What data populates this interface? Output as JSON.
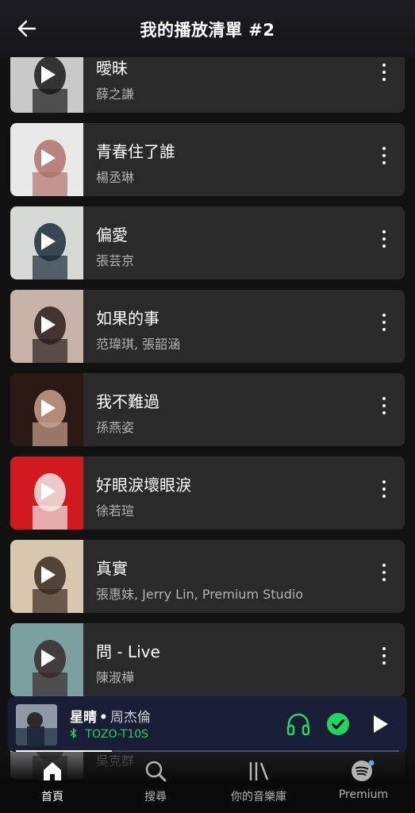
{
  "header": {
    "title": "我的播放清單 #2"
  },
  "songs": [
    {
      "title": "曖昧",
      "artist": "薛之謙",
      "cover_colors": [
        "#c9c9c9",
        "#1a1a1a"
      ]
    },
    {
      "title": "青春住了誰",
      "artist": "楊丞琳",
      "cover_colors": [
        "#e9e9e9",
        "#b0726a"
      ]
    },
    {
      "title": "偏愛",
      "artist": "張芸京",
      "cover_colors": [
        "#d6d9d4",
        "#1b2b3a"
      ]
    },
    {
      "title": "如果的事",
      "artist": "范瑋琪, 張韶涵",
      "cover_colors": [
        "#c8b3a8",
        "#2a1f1c"
      ]
    },
    {
      "title": "我不難過",
      "artist": "孫燕姿",
      "cover_colors": [
        "#2b1a14",
        "#c9a08a"
      ]
    },
    {
      "title": "好眼淚壞眼淚",
      "artist": "徐若瑄",
      "cover_colors": [
        "#d11a1e",
        "#f2e9e9"
      ]
    },
    {
      "title": "真實",
      "artist": "張惠妹, Jerry Lin, Premium Studio",
      "cover_colors": [
        "#d7c7ad",
        "#3b2b22"
      ]
    },
    {
      "title": "問 - Live",
      "artist": "陳淑樺",
      "cover_colors": [
        "#7aa0a0",
        "#3a2a2a"
      ]
    },
    {
      "title": "",
      "artist": "吳克群",
      "cover_colors": [
        "#cfcfcf",
        "#555555"
      ]
    }
  ],
  "now_playing": {
    "title": "星晴",
    "artist": "周杰倫",
    "device": "TOZO-T10S",
    "progress": 0.25,
    "accent": "#1ed760"
  },
  "nav": {
    "home": "首頁",
    "search": "搜尋",
    "library": "你的音樂庫",
    "premium": "Premium"
  }
}
